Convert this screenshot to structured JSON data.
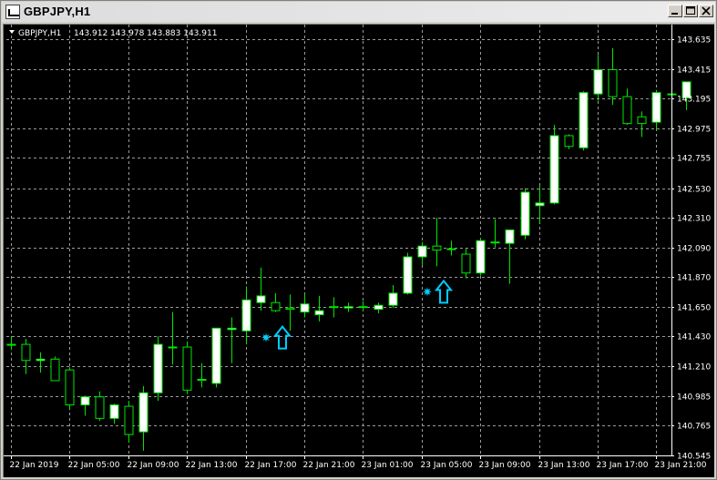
{
  "window": {
    "title": "GBPJPY,H1",
    "minimize_icon": "minimize-icon",
    "maximize_icon": "maximize-icon",
    "close_icon": "close-icon"
  },
  "info_line": {
    "symbol": "GBPJPY,H1",
    "values": "143.912 143.978 143.883 143.911"
  },
  "colors": {
    "background": "#000000",
    "grid": "#9a9a9a",
    "bull_fill": "#ffffff",
    "bear_fill": "#000000",
    "candle_stroke": "#00e600",
    "signal": "#00ccff"
  },
  "chart_data": {
    "type": "candlestick",
    "title": "GBPJPY,H1",
    "ylim": [
      140.545,
      143.745
    ],
    "y_ticks": [
      "143.635",
      "143.415",
      "143.195",
      "142.975",
      "142.755",
      "142.530",
      "142.310",
      "142.090",
      "141.870",
      "141.650",
      "141.430",
      "141.210",
      "140.985",
      "140.765",
      "140.545"
    ],
    "x_ticks": [
      "22 Jan 2019",
      "22 Jan 05:00",
      "22 Jan 09:00",
      "22 Jan 13:00",
      "22 Jan 17:00",
      "22 Jan 21:00",
      "23 Jan 01:00",
      "23 Jan 05:00",
      "23 Jan 09:00",
      "23 Jan 13:00",
      "23 Jan 17:00",
      "23 Jan 21:00"
    ],
    "grid": true,
    "candles": [
      {
        "o": 141.37,
        "h": 141.43,
        "l": 141.33,
        "c": 141.37
      },
      {
        "o": 141.37,
        "h": 141.41,
        "l": 141.15,
        "c": 141.25
      },
      {
        "o": 141.25,
        "h": 141.31,
        "l": 141.16,
        "c": 141.26
      },
      {
        "o": 141.26,
        "h": 141.28,
        "l": 141.13,
        "c": 141.1
      },
      {
        "o": 141.18,
        "h": 141.2,
        "l": 140.89,
        "c": 140.92
      },
      {
        "o": 140.92,
        "h": 140.99,
        "l": 140.84,
        "c": 140.98
      },
      {
        "o": 140.98,
        "h": 141.02,
        "l": 140.8,
        "c": 140.82
      },
      {
        "o": 140.82,
        "h": 140.93,
        "l": 140.78,
        "c": 140.92
      },
      {
        "o": 140.91,
        "h": 140.95,
        "l": 140.64,
        "c": 140.7
      },
      {
        "o": 140.72,
        "h": 141.06,
        "l": 140.58,
        "c": 141.01
      },
      {
        "o": 141.01,
        "h": 141.43,
        "l": 140.95,
        "c": 141.37
      },
      {
        "o": 141.35,
        "h": 141.61,
        "l": 141.22,
        "c": 141.35
      },
      {
        "o": 141.35,
        "h": 141.39,
        "l": 141.0,
        "c": 141.03
      },
      {
        "o": 141.11,
        "h": 141.23,
        "l": 141.05,
        "c": 141.11
      },
      {
        "o": 141.08,
        "h": 141.49,
        "l": 141.05,
        "c": 141.49
      },
      {
        "o": 141.48,
        "h": 141.57,
        "l": 141.23,
        "c": 141.49
      },
      {
        "o": 141.47,
        "h": 141.8,
        "l": 141.37,
        "c": 141.7
      },
      {
        "o": 141.68,
        "h": 141.94,
        "l": 141.62,
        "c": 141.73
      },
      {
        "o": 141.68,
        "h": 141.75,
        "l": 141.61,
        "c": 141.62
      },
      {
        "o": 141.64,
        "h": 141.74,
        "l": 141.47,
        "c": 141.63
      },
      {
        "o": 141.61,
        "h": 141.74,
        "l": 141.57,
        "c": 141.67
      },
      {
        "o": 141.59,
        "h": 141.73,
        "l": 141.54,
        "c": 141.62
      },
      {
        "o": 141.65,
        "h": 141.72,
        "l": 141.57,
        "c": 141.65
      },
      {
        "o": 141.64,
        "h": 141.68,
        "l": 141.61,
        "c": 141.65
      },
      {
        "o": 141.65,
        "h": 141.69,
        "l": 141.62,
        "c": 141.65
      },
      {
        "o": 141.63,
        "h": 141.68,
        "l": 141.6,
        "c": 141.66
      },
      {
        "o": 141.66,
        "h": 141.81,
        "l": 141.64,
        "c": 141.75
      },
      {
        "o": 141.75,
        "h": 142.05,
        "l": 141.74,
        "c": 142.02
      },
      {
        "o": 142.02,
        "h": 142.13,
        "l": 141.96,
        "c": 142.1
      },
      {
        "o": 142.1,
        "h": 142.31,
        "l": 141.95,
        "c": 142.07
      },
      {
        "o": 142.08,
        "h": 142.14,
        "l": 142.03,
        "c": 142.08
      },
      {
        "o": 142.04,
        "h": 142.08,
        "l": 141.86,
        "c": 141.9
      },
      {
        "o": 141.9,
        "h": 142.16,
        "l": 141.88,
        "c": 142.14
      },
      {
        "o": 142.13,
        "h": 142.3,
        "l": 142.09,
        "c": 142.13
      },
      {
        "o": 142.12,
        "h": 142.19,
        "l": 141.82,
        "c": 142.22
      },
      {
        "o": 142.18,
        "h": 142.53,
        "l": 142.15,
        "c": 142.5
      },
      {
        "o": 142.4,
        "h": 142.55,
        "l": 142.27,
        "c": 142.42
      },
      {
        "o": 142.42,
        "h": 143.0,
        "l": 142.41,
        "c": 142.92
      },
      {
        "o": 142.92,
        "h": 142.93,
        "l": 142.82,
        "c": 142.84
      },
      {
        "o": 142.83,
        "h": 143.25,
        "l": 142.81,
        "c": 143.24
      },
      {
        "o": 143.23,
        "h": 143.52,
        "l": 143.18,
        "c": 143.41
      },
      {
        "o": 143.41,
        "h": 143.57,
        "l": 143.15,
        "c": 143.21
      },
      {
        "o": 143.21,
        "h": 143.27,
        "l": 143.0,
        "c": 143.01
      },
      {
        "o": 143.06,
        "h": 143.1,
        "l": 142.91,
        "c": 143.01
      },
      {
        "o": 143.02,
        "h": 143.26,
        "l": 142.96,
        "c": 143.24
      },
      {
        "o": 143.23,
        "h": 143.3,
        "l": 143.15,
        "c": 143.23
      },
      {
        "o": 143.2,
        "h": 143.31,
        "l": 143.11,
        "c": 143.32
      }
    ],
    "signals": [
      {
        "index": 18,
        "type": "buy-arrow",
        "star": true
      },
      {
        "index": 29,
        "type": "buy-arrow",
        "star": true
      }
    ]
  }
}
